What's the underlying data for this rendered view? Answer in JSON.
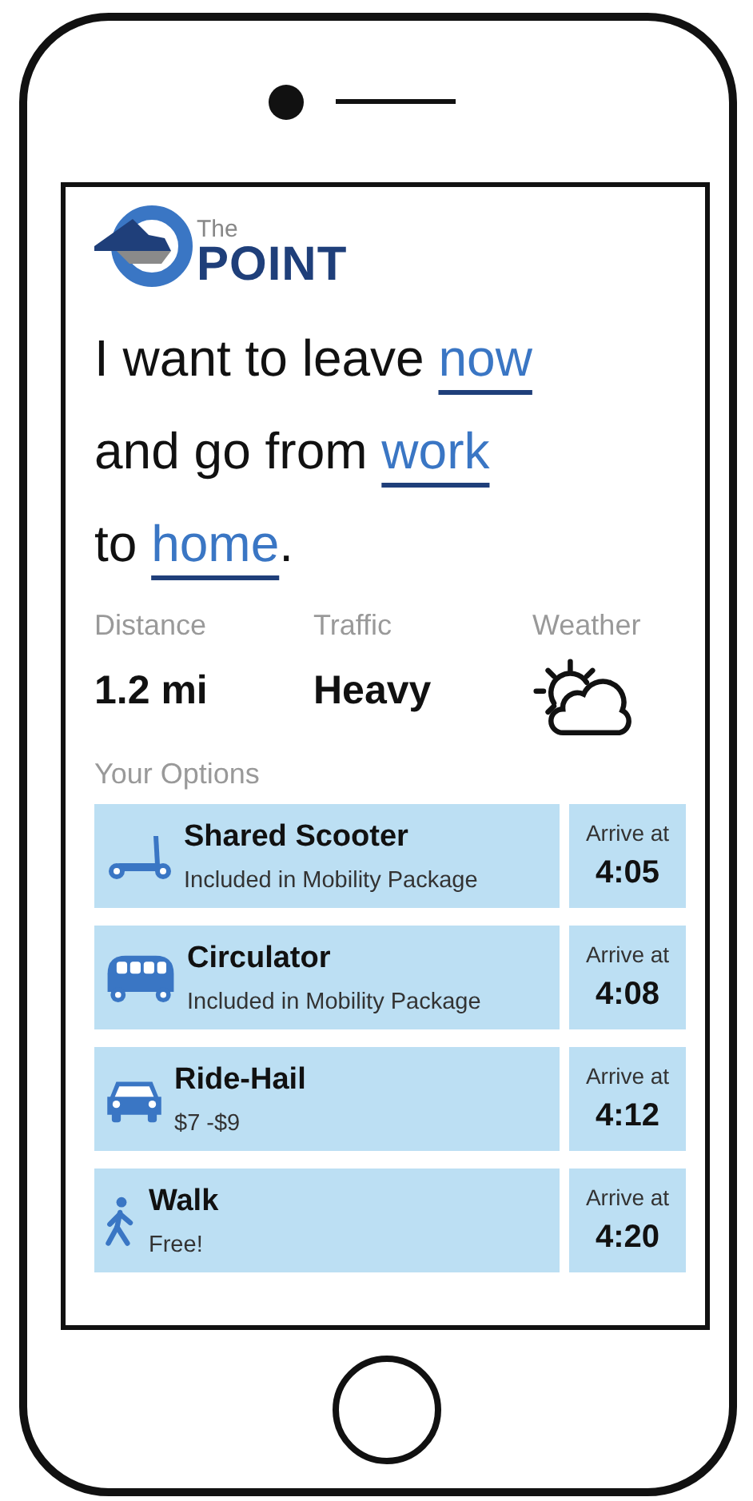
{
  "logo": {
    "small": "The",
    "big": "POINT"
  },
  "sentence": [
    [
      {
        "kind": "plain",
        "text": "I want to leave "
      },
      {
        "kind": "link",
        "text": "now"
      }
    ],
    [
      {
        "kind": "plain",
        "text": "and go from "
      },
      {
        "kind": "link",
        "text": "work"
      }
    ],
    [
      {
        "kind": "plain",
        "text": "to "
      },
      {
        "kind": "link",
        "text": "home"
      },
      {
        "kind": "plain",
        "text": "."
      }
    ]
  ],
  "stats": [
    {
      "label": "Distance",
      "kind": "text",
      "value": "1.2 mi"
    },
    {
      "label": "Traffic",
      "kind": "text",
      "value": "Heavy"
    },
    {
      "label": "Weather",
      "kind": "weather"
    }
  ],
  "options_label": "Your Options",
  "options": [
    {
      "kind": "scooter",
      "title": "Shared Scooter",
      "detail": "Included in Mobility Package",
      "arrive_label": "Arrive at",
      "time": "4:05"
    },
    {
      "kind": "bus",
      "title": "Circulator",
      "detail": "Included in Mobility Package",
      "arrive_label": "Arrive at",
      "time": "4:08"
    },
    {
      "kind": "car",
      "title": "Ride-Hail",
      "detail": "$7 -$9",
      "arrive_label": "Arrive at",
      "time": "4:12"
    },
    {
      "kind": "walk",
      "title": "Walk",
      "detail": "Free!",
      "arrive_label": "Arrive at",
      "time": "4:20"
    }
  ]
}
